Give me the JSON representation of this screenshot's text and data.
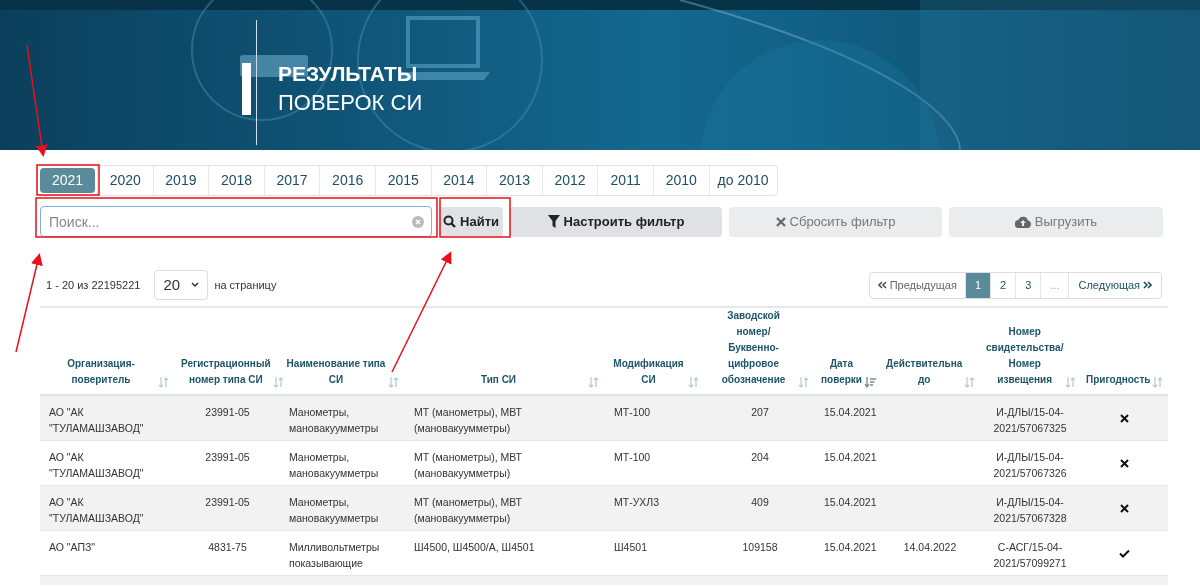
{
  "banner": {
    "title_line_1": "РЕЗУЛЬТАТЫ",
    "title_line_2": "ПОВЕРОК СИ"
  },
  "year_tabs": [
    {
      "label": "2021",
      "selected": true
    },
    {
      "label": "2020",
      "selected": false
    },
    {
      "label": "2019",
      "selected": false
    },
    {
      "label": "2018",
      "selected": false
    },
    {
      "label": "2017",
      "selected": false
    },
    {
      "label": "2016",
      "selected": false
    },
    {
      "label": "2015",
      "selected": false
    },
    {
      "label": "2014",
      "selected": false
    },
    {
      "label": "2013",
      "selected": false
    },
    {
      "label": "2012",
      "selected": false
    },
    {
      "label": "2011",
      "selected": false
    },
    {
      "label": "2010",
      "selected": false
    },
    {
      "label": "до 2010",
      "selected": false
    }
  ],
  "search": {
    "placeholder": "Поиск..."
  },
  "buttons": [
    {
      "kind": "search",
      "label": "Найти",
      "disabled": false
    },
    {
      "kind": "filter",
      "label": "Настроить фильтр",
      "disabled": false
    },
    {
      "kind": "reset",
      "label": "Сбросить фильтр",
      "disabled": true
    },
    {
      "kind": "export",
      "label": "Выгрузить",
      "disabled": true
    }
  ],
  "range_text": "1 - 20 из 22195221",
  "per_page": {
    "value": "20",
    "label": "на страницу"
  },
  "pagination": [
    {
      "kind": "prev",
      "label": "Предыдущая",
      "selected": false
    },
    {
      "kind": "page",
      "label": "1",
      "selected": true
    },
    {
      "kind": "page",
      "label": "2",
      "selected": false
    },
    {
      "kind": "page",
      "label": "3",
      "selected": false
    },
    {
      "kind": "gap",
      "label": "...",
      "selected": false
    },
    {
      "kind": "next",
      "label": "Следующая",
      "selected": false
    }
  ],
  "table": {
    "columns": [
      {
        "label": "Организация-поверитель",
        "sorted": false
      },
      {
        "label": "Регистрационный номер типа СИ",
        "sorted": false
      },
      {
        "label": "Наименование типа СИ",
        "sorted": false
      },
      {
        "label": "Тип СИ",
        "sorted": false
      },
      {
        "label": "Модификация СИ",
        "sorted": false
      },
      {
        "label": "Заводской номер/ Буквенно-цифровое обозначение",
        "sorted": false
      },
      {
        "label": "Дата поверки",
        "sorted": true
      },
      {
        "label": "Действительна до",
        "sorted": false
      },
      {
        "label": "Номер свидетельства/ Номер извещения",
        "sorted": false
      },
      {
        "label": "Пригодность",
        "sorted": false
      }
    ],
    "rows": [
      {
        "cells": [
          "АО \"АК \"ТУЛАМАШЗАВОД\"",
          "23991-05",
          "Манометры, мановакуумметры",
          "МТ (манометры), МВТ (мановакуумметры)",
          "МТ-100",
          "207",
          "15.04.2021",
          "",
          "И-ДЛЫ/15-04-2021/57067325"
        ],
        "suitable": false
      },
      {
        "cells": [
          "АО \"АК \"ТУЛАМАШЗАВОД\"",
          "23991-05",
          "Манометры, мановакуумметры",
          "МТ (манометры), МВТ (мановакуумметры)",
          "МТ-100",
          "204",
          "15.04.2021",
          "",
          "И-ДЛЫ/15-04-2021/57067326"
        ],
        "suitable": false
      },
      {
        "cells": [
          "АО \"АК \"ТУЛАМАШЗАВОД\"",
          "23991-05",
          "Манометры, мановакуумметры",
          "МТ (манометры), МВТ (мановакуумметры)",
          "МТ-УХЛ3",
          "409",
          "15.04.2021",
          "",
          "И-ДЛЫ/15-04-2021/57067328"
        ],
        "suitable": false
      },
      {
        "cells": [
          "АО \"АПЗ\"",
          "4831-75",
          "Милливольтметры показывающие",
          "Ш4500, Ш4500/А, Ш4501",
          "Ш4501",
          "109158",
          "15.04.2021",
          "14.04.2022",
          "С-АСГ/15-04-2021/57099271"
        ],
        "suitable": true
      }
    ]
  }
}
